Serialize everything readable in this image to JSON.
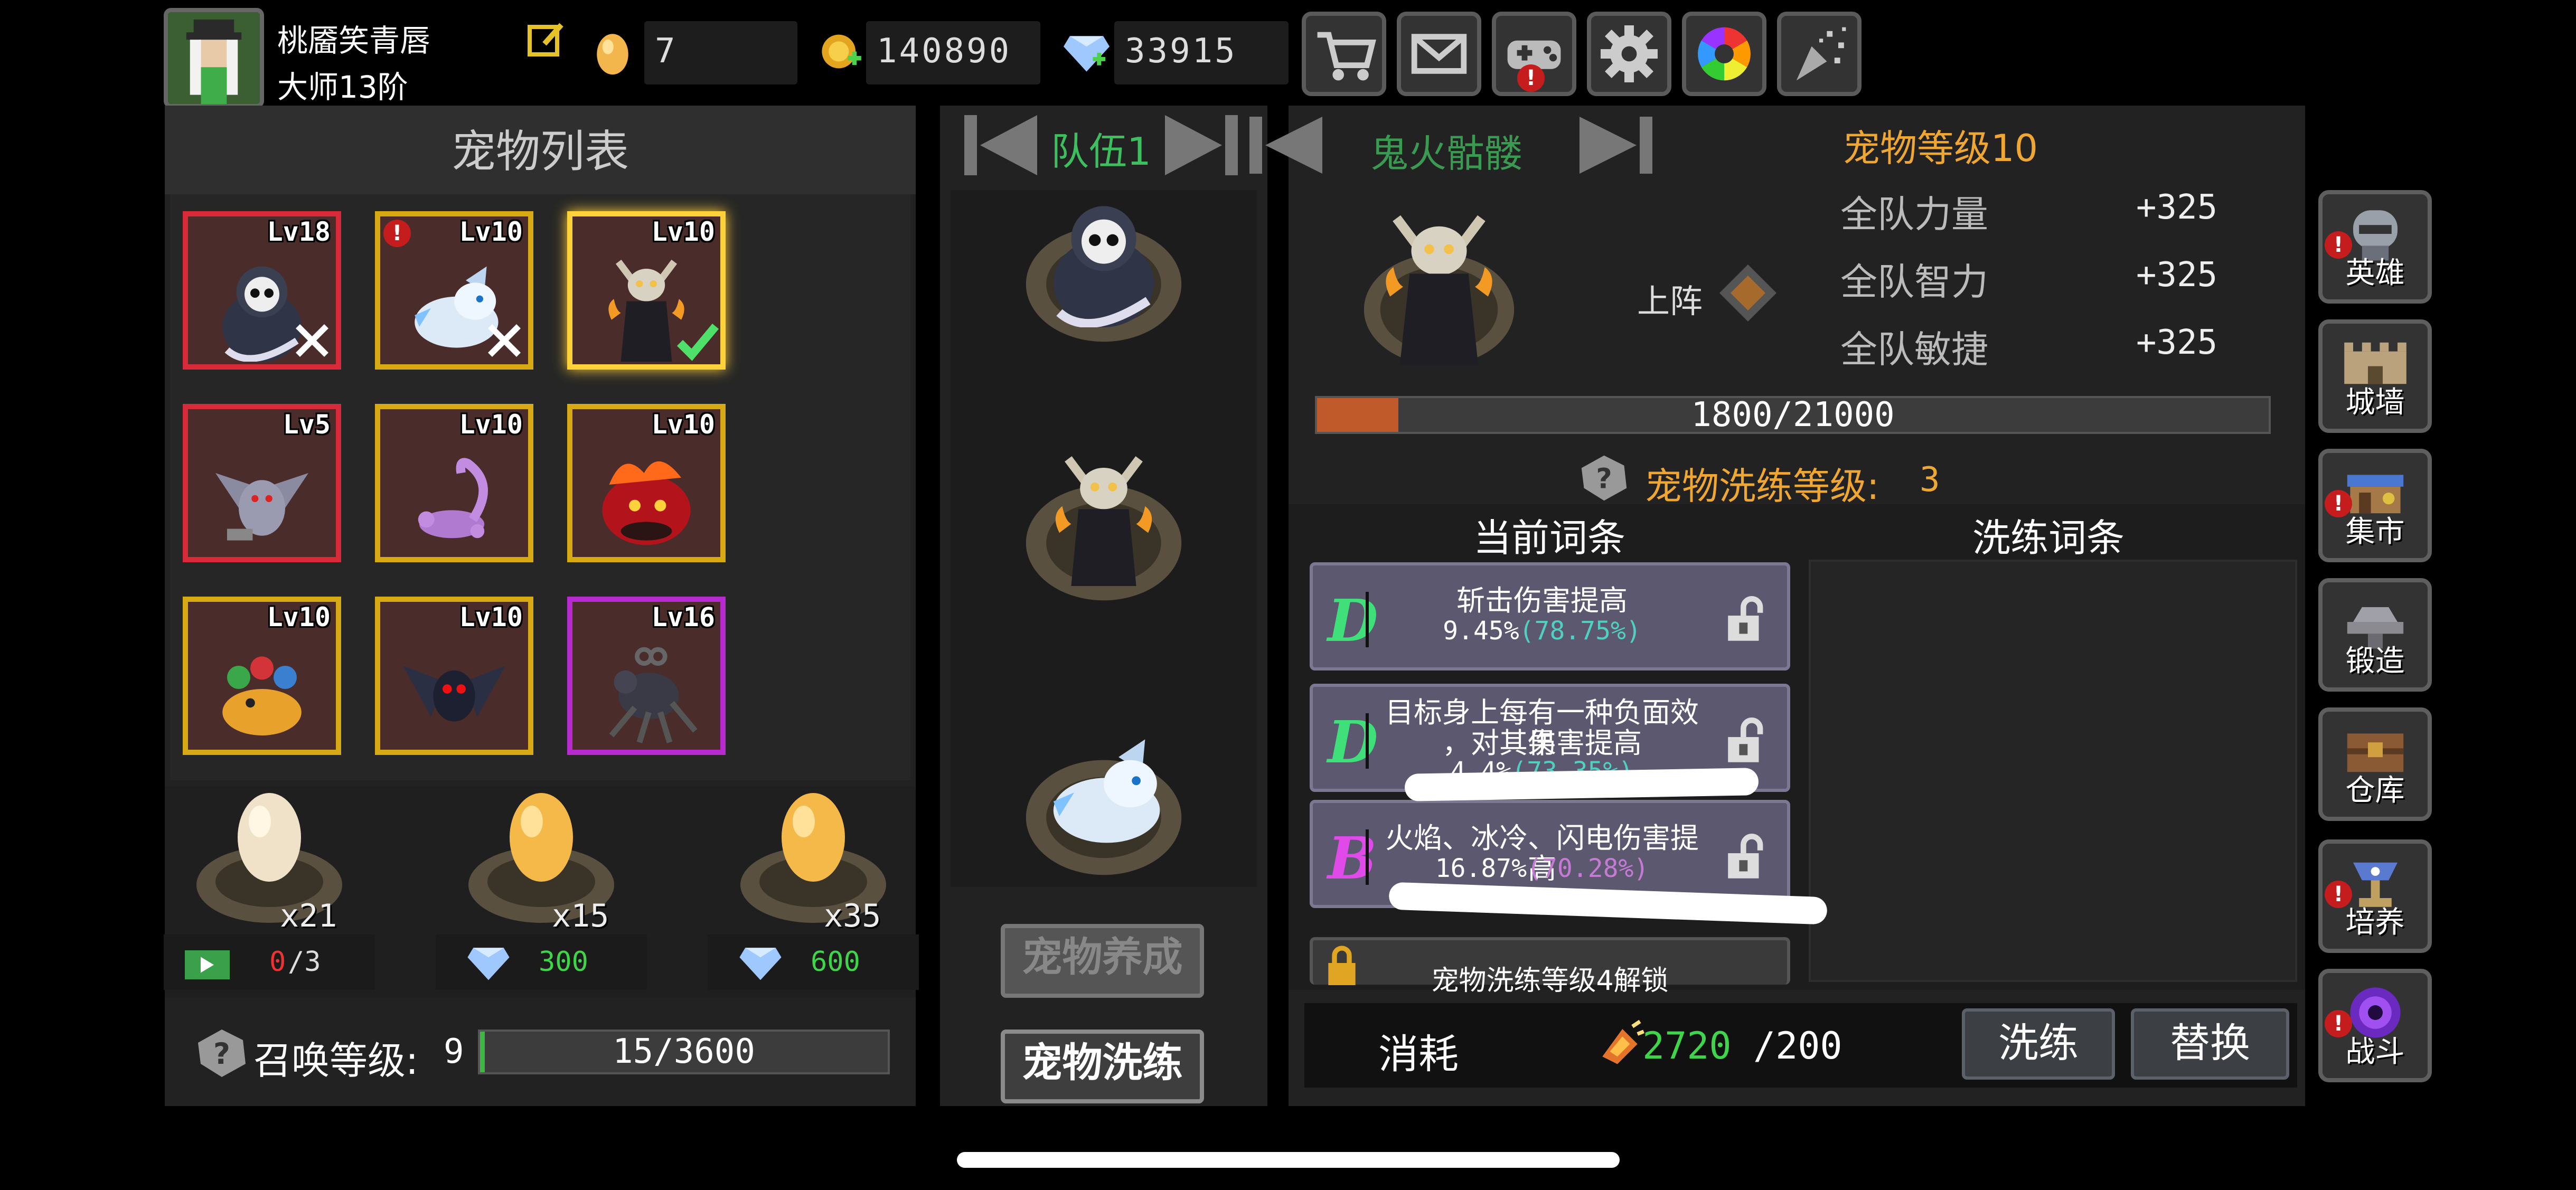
{
  "player": {
    "name": "桃靥笑青唇",
    "rank": "大师13阶"
  },
  "resources": {
    "eggs": "7",
    "gold": "140890",
    "diamonds": "33915"
  },
  "colors": {
    "accent_orange": "#f0a633",
    "green": "#3fd44a",
    "cyan": "#4fd0c0",
    "pink": "#c57bd3",
    "progress": "#c05a2b"
  },
  "pet_list": {
    "title": "宠物列表",
    "pets": [
      {
        "level": "Lv18",
        "name": "skull-reaper",
        "frame": "red"
      },
      {
        "level": "Lv10",
        "name": "ice-wolf",
        "frame": "gold",
        "alert": true
      },
      {
        "level": "Lv10",
        "name": "ghostfire-skeleton",
        "frame": "selected",
        "equipped": true
      },
      {
        "level": "Lv5",
        "name": "bat-creature",
        "frame": "red"
      },
      {
        "level": "Lv10",
        "name": "scorpion",
        "frame": "gold"
      },
      {
        "level": "Lv10",
        "name": "lava-beast",
        "frame": "gold"
      },
      {
        "level": "Lv10",
        "name": "flower-dragon",
        "frame": "gold"
      },
      {
        "level": "Lv10",
        "name": "dark-bat",
        "frame": "gold"
      },
      {
        "level": "Lv16",
        "name": "shadow-spider",
        "frame": "purple"
      }
    ]
  },
  "eggs": [
    {
      "count": "x21",
      "cost_used": "0",
      "cost_total": "/3",
      "cost_type": "ad"
    },
    {
      "count": "x15",
      "cost": "300",
      "cost_type": "diamond"
    },
    {
      "count": "x35",
      "cost": "600",
      "cost_type": "diamond"
    }
  ],
  "summon": {
    "label": "召唤等级:",
    "level": "9",
    "progress_text": "15/3600",
    "progress_fraction": 0.004
  },
  "team": {
    "name": "队伍1",
    "slots": [
      "ghostfire-skeleton",
      "ghostfire-skeleton",
      "ice-wolf"
    ],
    "nurture_button": "宠物养成",
    "refine_button": "宠物洗练"
  },
  "detail": {
    "pet_name": "鬼火骷髅",
    "deploy_label": "上阵",
    "level_text": "宠物等级10",
    "stats": [
      {
        "label": "全队力量",
        "value": "+325"
      },
      {
        "label": "全队智力",
        "value": "+325"
      },
      {
        "label": "全队敏捷",
        "value": "+325"
      }
    ],
    "exp_text": "1800/21000",
    "exp_fraction": 0.0857
  },
  "refine": {
    "title": "宠物洗练等级:",
    "level": "3",
    "current_header": "当前词条",
    "new_header": "洗练词条",
    "entries": [
      {
        "grade": "D",
        "name": "斩击伤害提高",
        "value": "9.45%",
        "pct": "(78.75%)"
      },
      {
        "grade": "D",
        "name": "目标身上每有一种负面效果",
        "name2": "，对其伤害提高",
        "value": "4.4%",
        "pct": "(73.35%)"
      },
      {
        "grade": "B",
        "name": "火焰、冰冷、闪电伤害提高",
        "value": "16.87%",
        "pct": "(70.28%)"
      }
    ],
    "locked_text": "宠物洗练等级4解锁",
    "cost_label": "消耗",
    "cost_have": "2720",
    "cost_need": "/200",
    "refine_button": "洗练",
    "replace_button": "替换"
  },
  "side_menu": [
    {
      "label": "英雄",
      "alert": true
    },
    {
      "label": "城墙",
      "alert": false
    },
    {
      "label": "集市",
      "alert": true
    },
    {
      "label": "锻造",
      "alert": false
    },
    {
      "label": "仓库",
      "alert": false
    },
    {
      "label": "培养",
      "alert": true
    },
    {
      "label": "战斗",
      "alert": true
    }
  ]
}
